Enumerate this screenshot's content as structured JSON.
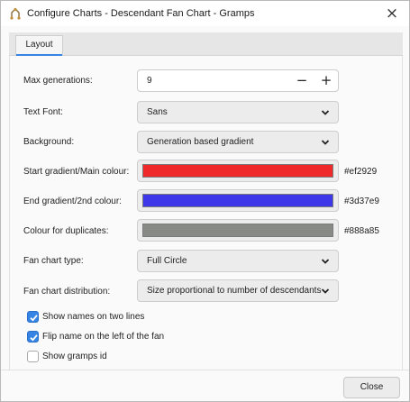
{
  "window": {
    "title": "Configure Charts - Descendant Fan Chart - Gramps"
  },
  "tabs": [
    {
      "label": "Layout",
      "active": true
    }
  ],
  "form": {
    "max_generations": {
      "label": "Max generations:",
      "value": "9",
      "minus": "−",
      "plus": "+"
    },
    "text_font": {
      "label": "Text Font:",
      "value": "Sans"
    },
    "background": {
      "label": "Background:",
      "value": "Generation based gradient"
    },
    "start_gradient": {
      "label": "Start gradient/Main colour:",
      "hex": "#ef2929",
      "color": "#ef2929"
    },
    "end_gradient": {
      "label": "End gradient/2nd colour:",
      "hex": "#3d37e9",
      "color": "#3d37e9"
    },
    "duplicates": {
      "label": "Colour for duplicates:",
      "hex": "#888a85",
      "color": "#888a85"
    },
    "fan_type": {
      "label": "Fan chart type:",
      "value": "Full Circle"
    },
    "fan_distribution": {
      "label": "Fan chart distribution:",
      "value": "Size proportional to number of descendants"
    }
  },
  "checkboxes": {
    "two_lines": {
      "label": "Show names on two lines",
      "checked": true
    },
    "flip_name": {
      "label": "Flip name on the left of the fan",
      "checked": true
    },
    "gramps_id": {
      "label": "Show gramps id",
      "checked": false
    }
  },
  "footer": {
    "close_label": "Close"
  },
  "colors": {
    "accent": "#3584e4"
  }
}
